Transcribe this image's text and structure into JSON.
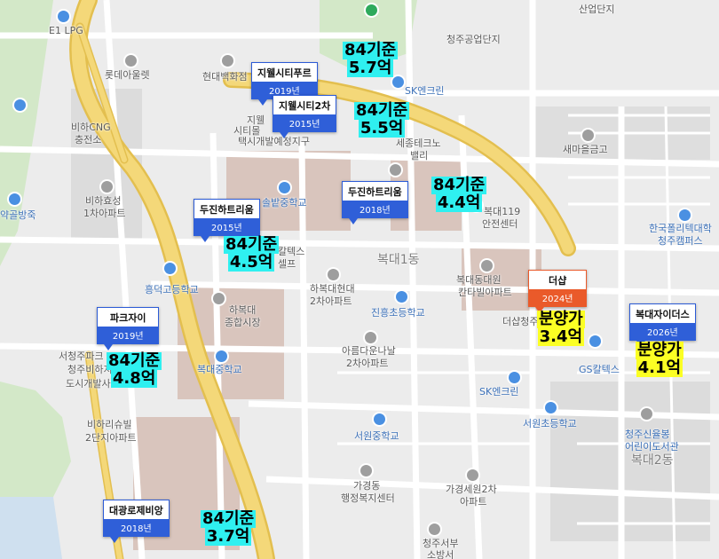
{
  "colors": {
    "road_major": "#f4d879",
    "road_major_edge": "#e3bf4f",
    "road_minor": "#ffffff",
    "block": "#dcdcdc",
    "block_brown": "#d9c5bd",
    "green": "#d3e8c8",
    "water": "#cfe0ef",
    "card_blue": "#2f5fd8",
    "card_orange": "#ea5a2a",
    "price_cyan": "#2ff0f0",
    "price_yellow": "#fbff24"
  },
  "places": {
    "lpg": "E1 LPG",
    "lotte": "롯데아울렛",
    "hyundai_dept": "현대백화점",
    "cjgongup": "청주공업단지",
    "sandan": "산업단지",
    "sk1": "SK엔크린",
    "bihacng": "비하CNG",
    "bihacng2": "충전소",
    "sejong": "세종테크노",
    "sejong2": "밸리",
    "saemaeul": "새마을금고",
    "bihahyosung": "비하효성",
    "bihahyosung2": "1차아파트",
    "taxi": "택시개발예정지구",
    "jiwell_small": "지웰",
    "jiwell_small2": "시티몰",
    "bokdaejung_school": "솔밭중학교",
    "bokdae119": "복대119",
    "bokdae119b": "안전센터",
    "polytech": "한국폴리텍대학",
    "polytech2": "청주캠퍼스",
    "gyaksong": "약골방죽",
    "heungdeok": "흥덕고등학교",
    "galtex1": "칼텍스",
    "galtex1b": "셀프",
    "bokdae1dong": "복대1동",
    "bokdaedongwon": "복대동대원",
    "bokdaedongwon2": "칸타빌아파트",
    "hyundai2": "하복대현대",
    "hyundai2b": "2차아파트",
    "jinheung": "진흥초등학교",
    "hbd_market": "하복대",
    "hbd_market2": "종합시장",
    "bokdae_mid": "복대중학교",
    "areum": "아름다운나날",
    "areum2": "2차아파트",
    "seocheongju": "서청주파크",
    "seocheongju2": "청주비하지구",
    "seocheongju3": "도시개발사업",
    "gscaltex": "GS칼텍스",
    "sk2": "SK엔크린",
    "seowonelem": "서원초등학교",
    "seowonmid": "서원중학교",
    "bihari": "비하리슈빌",
    "bihari2": "2단지아파트",
    "cheongjusinyul": "청주신율봉",
    "cheongjusinyul2": "어린이도서관",
    "bokdae2dong": "복대2동",
    "gagyeong": "가경동",
    "gagyeong2": "행정복지센터",
    "gaseowon": "가경세원2차",
    "gaseowon2": "아파트",
    "seobu": "청주서부",
    "seobu2": "소방서",
    "theshop_bottom": "더샵청주"
  },
  "cards": [
    {
      "name": "지웰시티푸르",
      "year": "2019년",
      "style": "blue"
    },
    {
      "name": "지웰시티2차",
      "year": "2015년",
      "style": "blue"
    },
    {
      "name": "두진하트리움",
      "year": "2018년",
      "style": "blue"
    },
    {
      "name": "두진하트리움",
      "year": "2015년",
      "style": "blue"
    },
    {
      "name": "파크자이",
      "year": "2019년",
      "style": "blue"
    },
    {
      "name": "더샵",
      "year": "2024년",
      "style": "orange"
    },
    {
      "name": "복대자이더스",
      "year": "2026년",
      "style": "blue"
    },
    {
      "name": "대광로제비앙",
      "year": "2018년",
      "style": "blue"
    }
  ],
  "prices": [
    {
      "line1": "84기준",
      "line2": "5.7억",
      "style": "cyan"
    },
    {
      "line1": "84기준",
      "line2": "5.5억",
      "style": "cyan"
    },
    {
      "line1": "84기준",
      "line2": "4.4억",
      "style": "cyan"
    },
    {
      "line1": "84기준",
      "line2": "4.5억",
      "style": "cyan"
    },
    {
      "line1": "84기준",
      "line2": "4.8억",
      "style": "cyan"
    },
    {
      "line1": "분양가",
      "line2": "3.4억",
      "style": "yellow"
    },
    {
      "line1": "분양가",
      "line2": "4.1억",
      "style": "yellow"
    },
    {
      "line1": "84기준",
      "line2": "3.7억",
      "style": "cyan"
    }
  ]
}
